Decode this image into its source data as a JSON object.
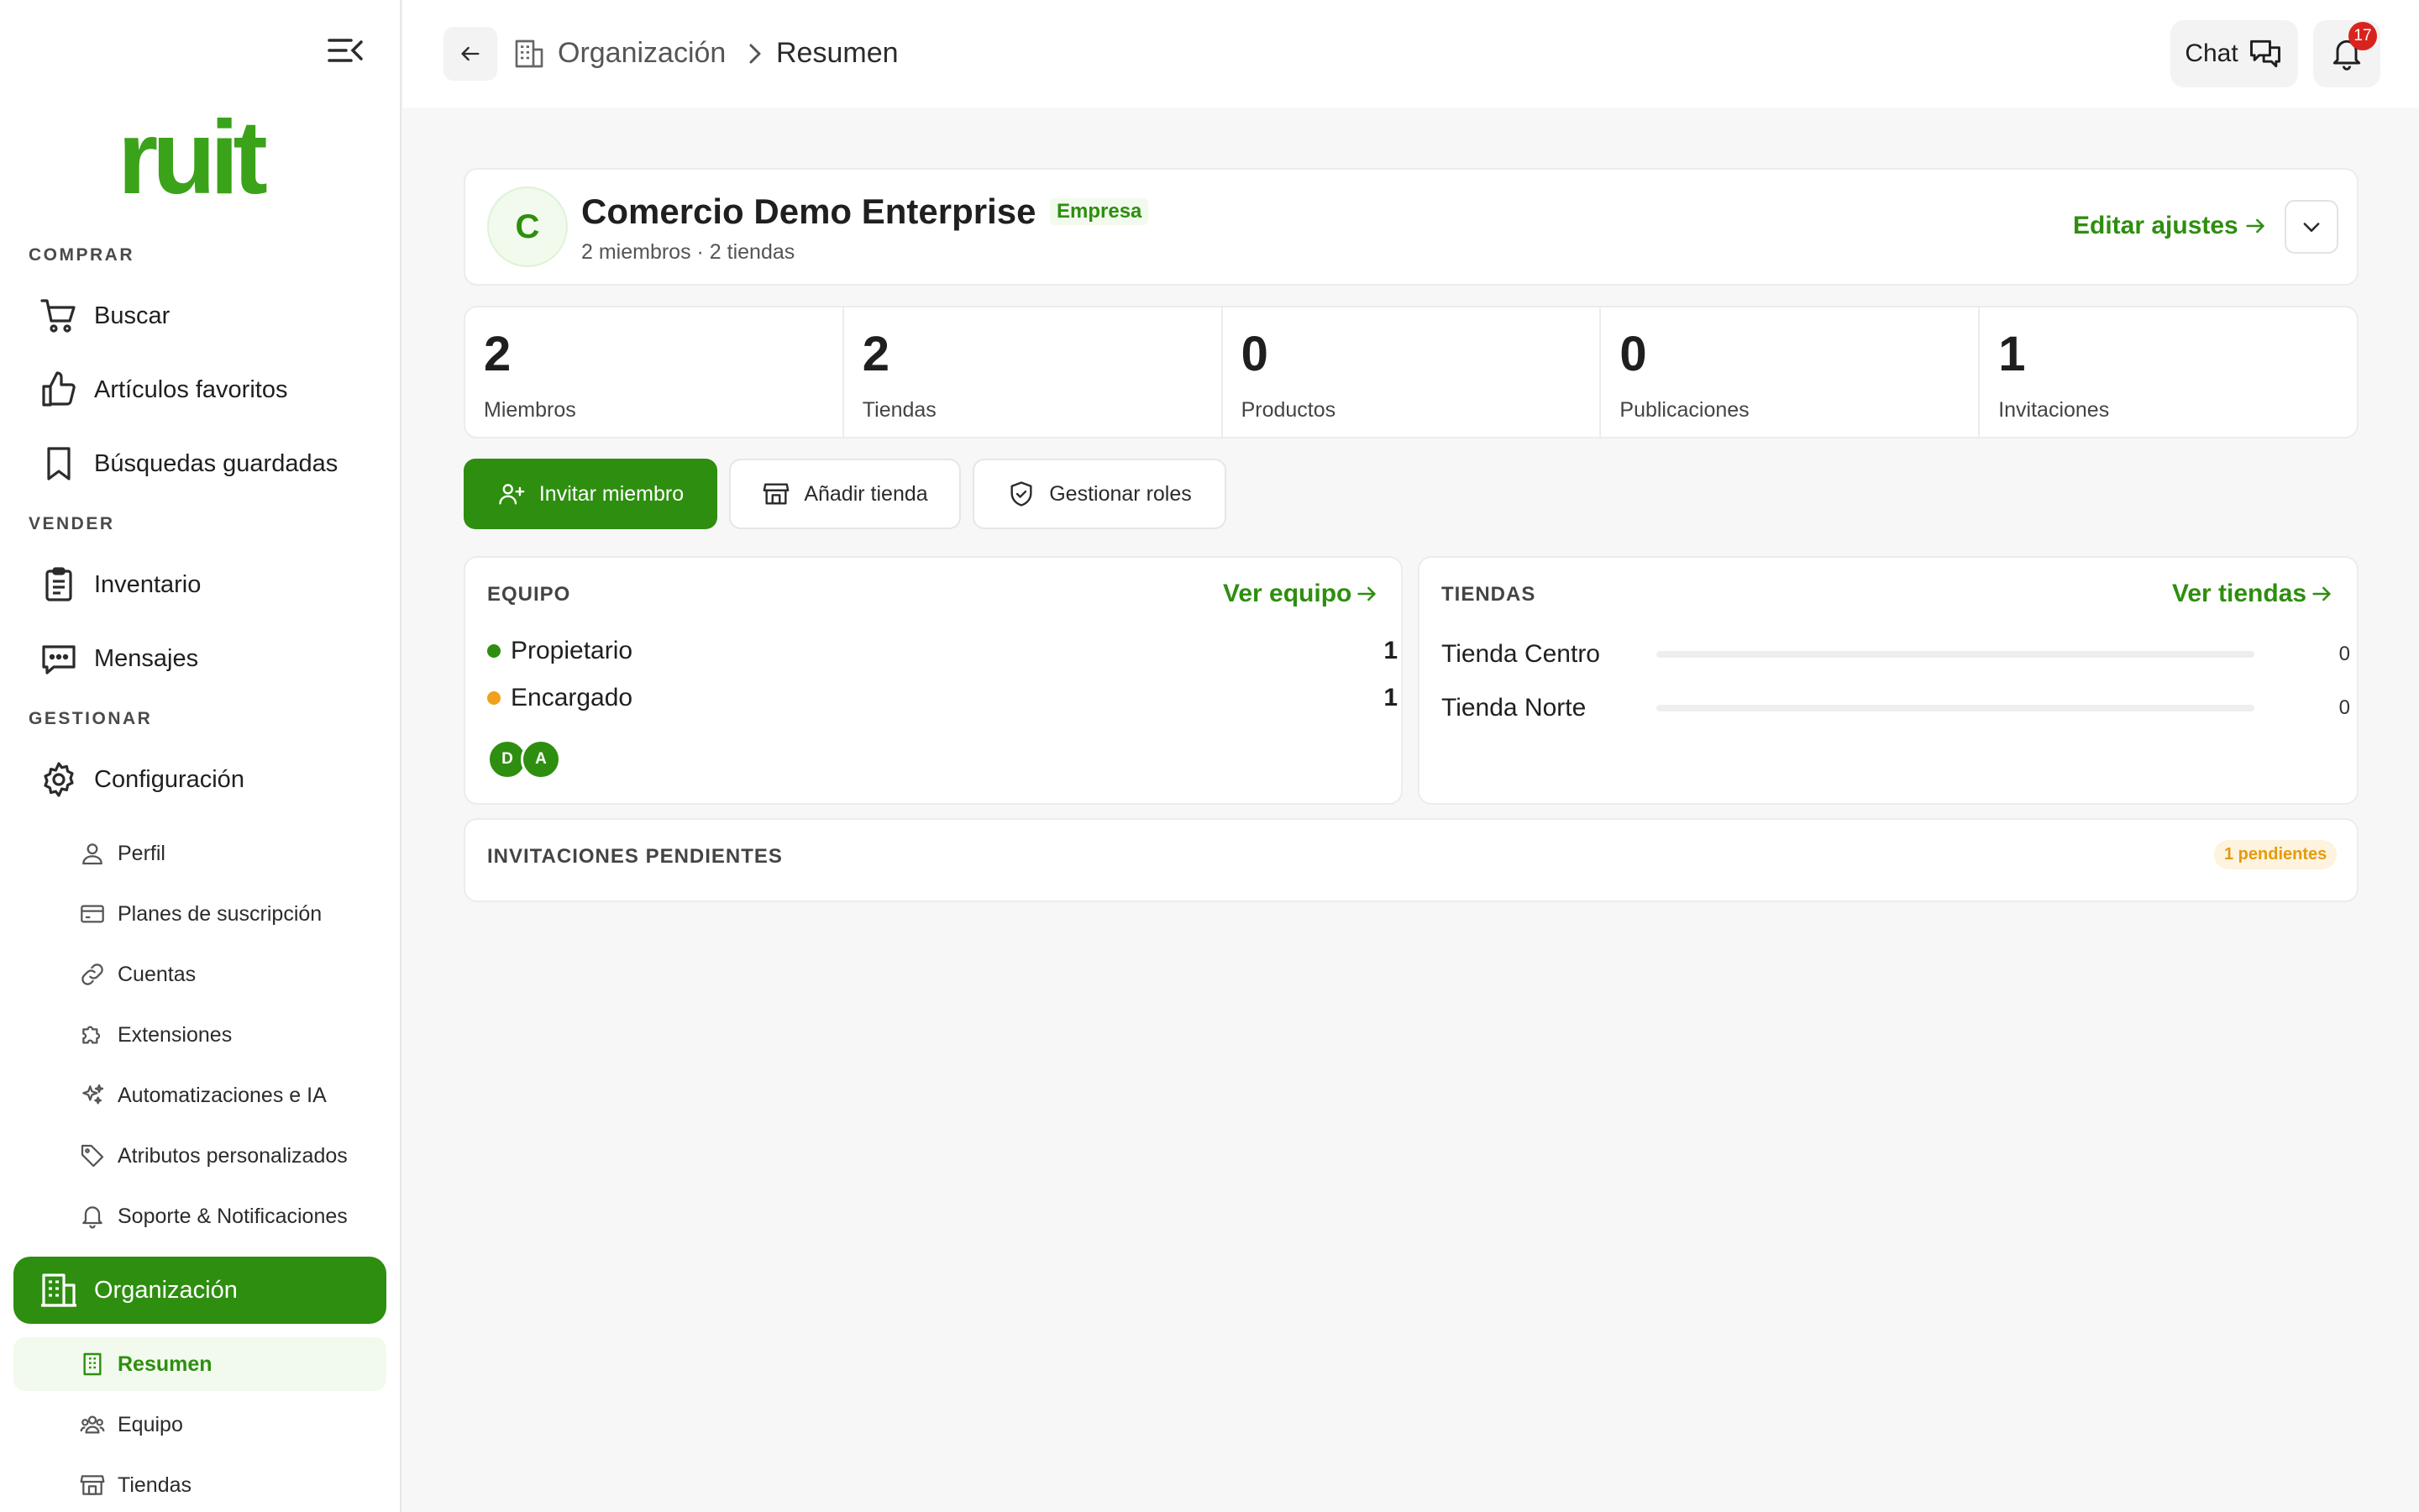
{
  "sidebar": {
    "logo": "ruit",
    "sections": {
      "buy": "COMPRAR",
      "sell": "VENDER",
      "manage": "GESTIONAR"
    },
    "items": {
      "search": "Buscar",
      "favorites": "Artículos favoritos",
      "saved_searches": "Búsquedas guardadas",
      "inventory": "Inventario",
      "messages": "Mensajes",
      "settings": "Configuración",
      "profile": "Perfil",
      "plans": "Planes de suscripción",
      "accounts": "Cuentas",
      "extensions": "Extensiones",
      "automations": "Automatizaciones e IA",
      "attributes": "Atributos personalizados",
      "support": "Soporte & Notificaciones",
      "organization": "Organización",
      "summary": "Resumen",
      "team": "Equipo",
      "stores": "Tiendas"
    }
  },
  "topbar": {
    "breadcrumb_parent": "Organización",
    "breadcrumb_current": "Resumen",
    "chat_label": "Chat",
    "notification_count": "17"
  },
  "org": {
    "initial": "C",
    "name": "Comercio Demo Enterprise",
    "tag": "Empresa",
    "subtitle": "2 miembros · 2 tiendas",
    "edit_label": "Editar ajustes"
  },
  "stats": [
    {
      "value": "2",
      "label": "Miembros"
    },
    {
      "value": "2",
      "label": "Tiendas"
    },
    {
      "value": "0",
      "label": "Productos"
    },
    {
      "value": "0",
      "label": "Publicaciones"
    },
    {
      "value": "1",
      "label": "Invitaciones"
    }
  ],
  "actions": {
    "invite": "Invitar miembro",
    "add_store": "Añadir tienda",
    "manage_roles": "Gestionar roles"
  },
  "team_panel": {
    "title": "EQUIPO",
    "link": "Ver equipo",
    "roles": [
      {
        "name": "Propietario",
        "count": "1",
        "color": "#2e8e0f"
      },
      {
        "name": "Encargado",
        "count": "1",
        "color": "#f0a01a"
      }
    ],
    "member_initials": [
      "D",
      "A"
    ]
  },
  "stores_panel": {
    "title": "TIENDAS",
    "link": "Ver tiendas",
    "stores": [
      {
        "name": "Tienda Centro",
        "value": "0",
        "fill_fraction": 0
      },
      {
        "name": "Tienda Norte",
        "value": "0",
        "fill_fraction": 0
      }
    ]
  },
  "invitations": {
    "title": "INVITACIONES PENDIENTES",
    "badge": "1 pendientes"
  },
  "colors": {
    "brand": "#2e8e0f",
    "logo": "#3aa31a",
    "warning": "#f0a01a",
    "alert": "#d8241f"
  }
}
